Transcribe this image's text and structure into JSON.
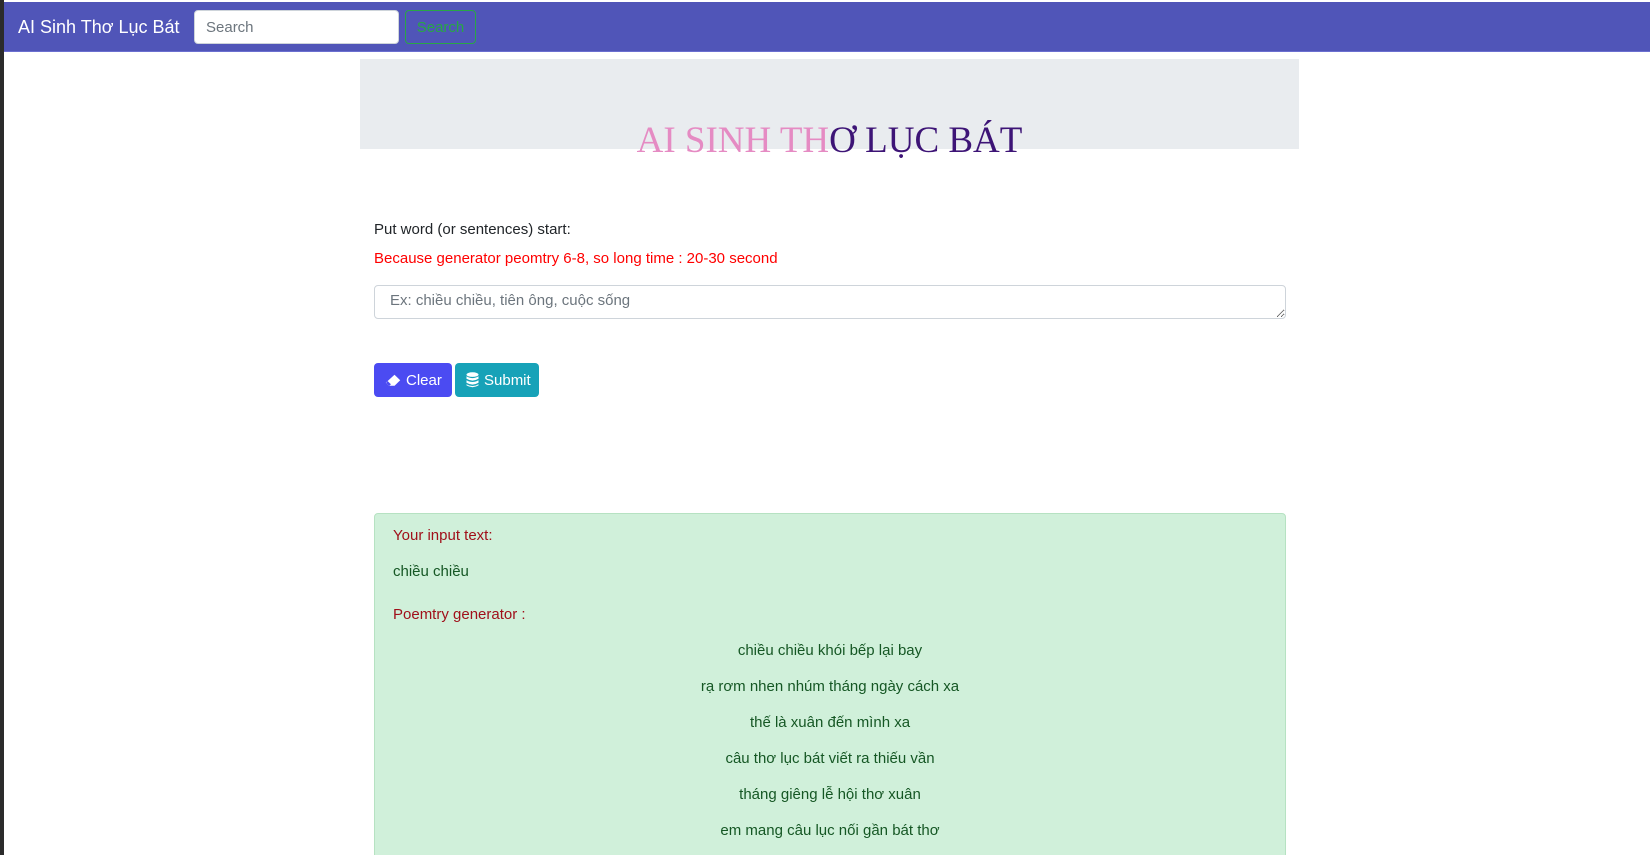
{
  "navbar": {
    "brand": "AI Sinh Thơ Lục Bát",
    "search_placeholder": "Search",
    "search_button": "Search"
  },
  "header": {
    "title_part_a": "AI SINH TH",
    "title_part_b": "Ơ LỤC BÁT",
    "colors": {
      "part_a": "#e58bc3",
      "part_b": "#3d1476"
    }
  },
  "form": {
    "prompt_label": "Put word (or sentences) start:",
    "warning": "Because generator peomtry 6-8, so long time : 20-30 second",
    "input_placeholder": "Ex: chiều chiều, tiên ông, cuộc sống",
    "input_value": "",
    "clear_button": "Clear",
    "clear_icon": "eraser-icon",
    "submit_button": "Submit",
    "submit_icon": "database-icon"
  },
  "result": {
    "input_label": "Your input text:",
    "input_text": "chiều chiều",
    "poem_label": "Poemtry generator :",
    "poem_lines": [
      "chiều chiều khói bếp lại bay",
      "rạ rơm nhen nhúm tháng ngày cách xa",
      "thế là xuân đến mình xa",
      "câu thơ lục bát viết ra thiếu vần",
      "tháng giêng lễ hội thơ xuân",
      "em mang câu lục nối gần bát thơ"
    ]
  },
  "colors": {
    "navbar": "#5055b8",
    "clear_button": "#4b4bf2",
    "submit_button": "#17a2b8",
    "warning": "#ff0000",
    "result_background": "#d0f0da"
  }
}
